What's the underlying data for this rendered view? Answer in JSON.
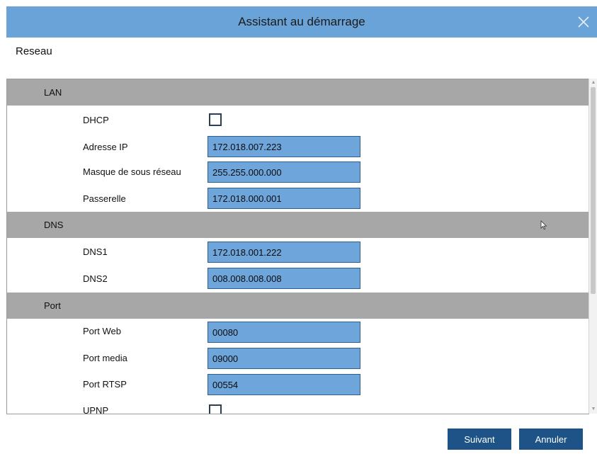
{
  "dialog": {
    "title": "Assistant au démarrage",
    "close_icon": "close-icon"
  },
  "section": {
    "title": "Reseau"
  },
  "groups": {
    "lan": {
      "label": "LAN",
      "dhcp_label": "DHCP",
      "dhcp_checked": false,
      "ip_label": "Adresse IP",
      "ip_value": "172.018.007.223",
      "mask_label": "Masque de sous réseau",
      "mask_value": "255.255.000.000",
      "gateway_label": "Passerelle",
      "gateway_value": "172.018.000.001"
    },
    "dns": {
      "label": "DNS",
      "dns1_label": "DNS1",
      "dns1_value": "172.018.001.222",
      "dns2_label": "DNS2",
      "dns2_value": "008.008.008.008"
    },
    "port": {
      "label": "Port",
      "web_label": "Port Web",
      "web_value": "00080",
      "media_label": "Port media",
      "media_value": "09000",
      "rtsp_label": "Port RTSP",
      "rtsp_value": "00554",
      "upnp_label": "UPNP",
      "upnp_checked": false
    }
  },
  "footer": {
    "next_label": "Suivant",
    "cancel_label": "Annuler"
  },
  "colors": {
    "titlebar": "#6aa3d8",
    "group_header": "#a7a7a7",
    "field": "#6ea6dc",
    "button": "#1d5386"
  }
}
